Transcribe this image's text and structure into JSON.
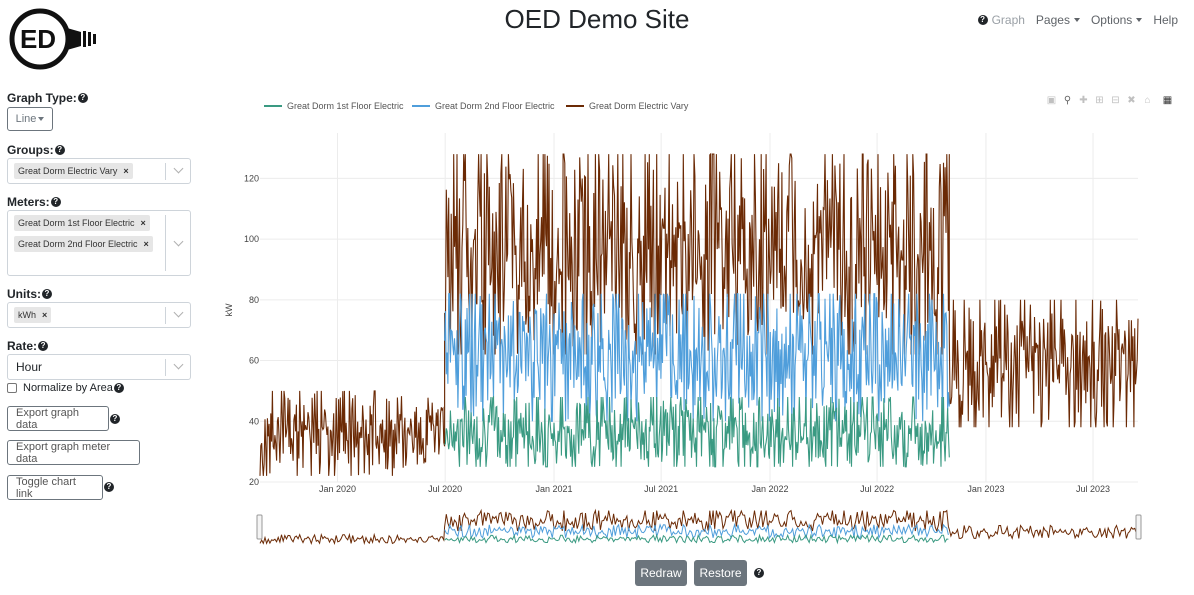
{
  "app": {
    "title": "OED Demo Site",
    "logo_text": "ED"
  },
  "nav": {
    "graph_label": "Graph",
    "pages_label": "Pages",
    "options_label": "Options",
    "help_label": "Help"
  },
  "sidebar": {
    "graph_type": {
      "label": "Graph Type:",
      "value": "Line"
    },
    "groups": {
      "label": "Groups:",
      "selected": [
        "Great Dorm Electric Vary"
      ]
    },
    "meters": {
      "label": "Meters:",
      "selected": [
        "Great Dorm 1st Floor Electric",
        "Great Dorm 2nd Floor Electric"
      ]
    },
    "units": {
      "label": "Units:",
      "selected": [
        "kWh"
      ]
    },
    "rate": {
      "label": "Rate:",
      "value": "Hour"
    },
    "normalize": {
      "label": "Normalize by Area",
      "checked": false
    },
    "export_graph_label": "Export graph data",
    "export_meter_label": "Export graph meter data",
    "toggle_link_label": "Toggle chart link"
  },
  "chart_buttons": {
    "redraw_label": "Redraw",
    "restore_label": "Restore"
  },
  "colors": {
    "series1": "#3a9a82",
    "series2": "#4f9edb",
    "series3": "#6b2a05"
  },
  "chart_data": {
    "type": "line",
    "ylabel": "kW",
    "xlabel": "",
    "ylim": [
      20,
      130
    ],
    "y_ticks": [
      "20",
      "40",
      "60",
      "80",
      "100",
      "120"
    ],
    "x_ticks": [
      "Jan 2020",
      "Jul 2020",
      "Jan 2021",
      "Jul 2021",
      "Jan 2022",
      "Jul 2022",
      "Jan 2023",
      "Jul 2023"
    ],
    "x_range": [
      "2019-08-23",
      "2023-09-15"
    ],
    "legend_position": "top-left",
    "series": [
      {
        "name": "Great Dorm 1st Floor Electric",
        "x_start": "2020-06-30",
        "x_end": "2022-10-31",
        "mean": 37,
        "min": 25,
        "max": 48
      },
      {
        "name": "Great Dorm 2nd Floor Electric",
        "x_start": "2020-06-30",
        "x_end": "2022-10-31",
        "mean": 62,
        "min": 40,
        "max": 82
      },
      {
        "name": "Great Dorm Electric Vary",
        "segments": [
          {
            "x_start": "2019-08-23",
            "x_end": "2020-06-30",
            "mean": 37,
            "min": 22,
            "max": 50
          },
          {
            "x_start": "2020-06-30",
            "x_end": "2022-10-31",
            "mean": 98,
            "min": 62,
            "max": 128
          },
          {
            "x_start": "2022-10-31",
            "x_end": "2023-09-15",
            "mean": 58,
            "min": 38,
            "max": 80
          }
        ]
      }
    ]
  }
}
